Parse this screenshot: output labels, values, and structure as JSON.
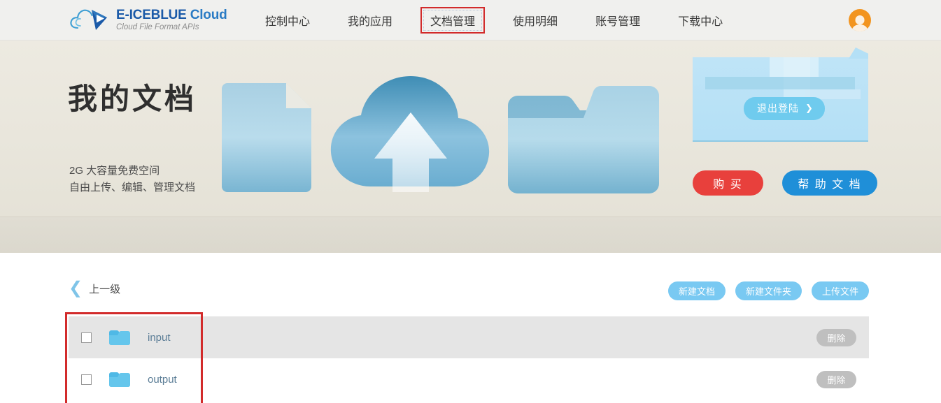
{
  "header": {
    "logo": {
      "icon": "cloud-play-logo-icon",
      "title_bold": "E-ICEBLUE",
      "title_light": " Cloud",
      "subtitle": "Cloud File Format APIs"
    },
    "nav": [
      {
        "label": "控制中心",
        "active": false
      },
      {
        "label": "我的应用",
        "active": false
      },
      {
        "label": "文档管理",
        "active": true
      },
      {
        "label": "使用明细",
        "active": false
      },
      {
        "label": "账号管理",
        "active": false
      },
      {
        "label": "下载中心",
        "active": false
      }
    ],
    "avatar_icon": "user-avatar-icon"
  },
  "hero": {
    "title": "我的文档",
    "subtitle_line1": "2G 大容量免费空间",
    "subtitle_line2": "自由上传、编辑、管理文档",
    "art": [
      {
        "icon": "document-illustration"
      },
      {
        "icon": "cloud-upload-illustration"
      },
      {
        "icon": "folder-illustration"
      }
    ],
    "promo": {
      "logout_label": "退出登陆",
      "logout_chevron": "❯"
    },
    "cta": [
      {
        "label": "购 买",
        "color": "#e8403c",
        "name": "buy-button"
      },
      {
        "label": "帮 助 文 档",
        "color": "#1f8fd8",
        "name": "help-doc-button"
      }
    ]
  },
  "toolbar": {
    "up_level_label": "上一级",
    "back_chevron": "❮",
    "buttons": [
      {
        "label": "新建文档",
        "name": "new-document-button"
      },
      {
        "label": "新建文件夹",
        "name": "new-folder-button"
      },
      {
        "label": "上传文件",
        "name": "upload-file-button"
      }
    ]
  },
  "file_list": {
    "delete_label": "删除",
    "rows": [
      {
        "name": "input",
        "type": "folder",
        "checked": false,
        "highlighted": true
      },
      {
        "name": "output",
        "type": "folder",
        "checked": false,
        "highlighted": false
      }
    ]
  },
  "colors": {
    "accent_blue": "#1b5aa8",
    "button_blue": "#79c9f2",
    "buy_red": "#e8403c",
    "help_blue": "#1f8fd8",
    "annotation_red": "#d22b2b",
    "folder_blue": "#5ec1ea",
    "row_highlight": "#e5e5e5",
    "hero_bg": "#eae7dd",
    "band_bg": "#dedad0"
  }
}
